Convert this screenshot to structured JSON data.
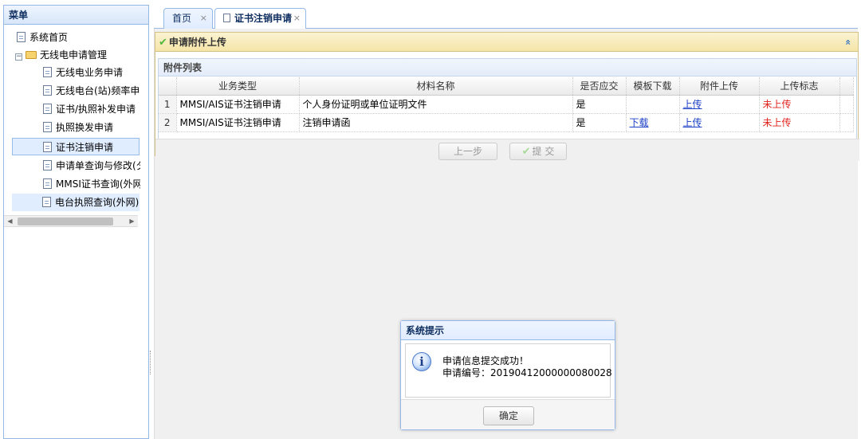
{
  "menu": {
    "title": "菜单",
    "items": [
      {
        "label": "系统首页",
        "type": "doc",
        "level": 0
      },
      {
        "label": "无线电申请管理",
        "type": "folder",
        "level": 0
      },
      {
        "label": "无线电业务申请",
        "type": "doc",
        "level": 1
      },
      {
        "label": "无线电台(站)频率申",
        "type": "doc",
        "level": 1
      },
      {
        "label": "证书/执照补发申请",
        "type": "doc",
        "level": 1
      },
      {
        "label": "执照换发申请",
        "type": "doc",
        "level": 1
      },
      {
        "label": "证书注销申请",
        "type": "doc",
        "level": 1,
        "selected": true
      },
      {
        "label": "申请单查询与修改(夕",
        "type": "doc",
        "level": 1
      },
      {
        "label": "MMSI证书查询(外网",
        "type": "doc",
        "level": 1
      },
      {
        "label": "电台执照查询(外网)",
        "type": "doc",
        "level": 1,
        "highlight": true
      }
    ]
  },
  "tabs": [
    {
      "label": "首页",
      "close": "×"
    },
    {
      "label": "证书注销申请",
      "close": "×",
      "active": true
    }
  ],
  "upload_panel": {
    "title": "申请附件上传",
    "collapse": "«",
    "list_title": "附件列表",
    "columns": [
      "业务类型",
      "材料名称",
      "是否应交",
      "模板下载",
      "附件上传",
      "上传标志"
    ],
    "rows": [
      {
        "num": "1",
        "biz_type": "MMSI/AIS证书注销申请",
        "material": "个人身份证明或单位证明文件",
        "required": "是",
        "template": "",
        "upload": "上传",
        "status": "未上传"
      },
      {
        "num": "2",
        "biz_type": "MMSI/AIS证书注销申请",
        "material": "注销申请函",
        "required": "是",
        "template": "下载",
        "upload": "上传",
        "status": "未上传"
      }
    ],
    "prev_button": "上一步",
    "submit_button": "提 交"
  },
  "dialog": {
    "title": "系统提示",
    "icon": "info-icon",
    "line1": "申请信息提交成功！",
    "line2": "申请编号：20190412000000080028",
    "ok_button": "确定"
  },
  "colors": {
    "border_blue": "#95b8e7",
    "header_gold": "#f5e5a8",
    "status_red": "#e0231f",
    "link_blue": "#1c3fc5"
  }
}
